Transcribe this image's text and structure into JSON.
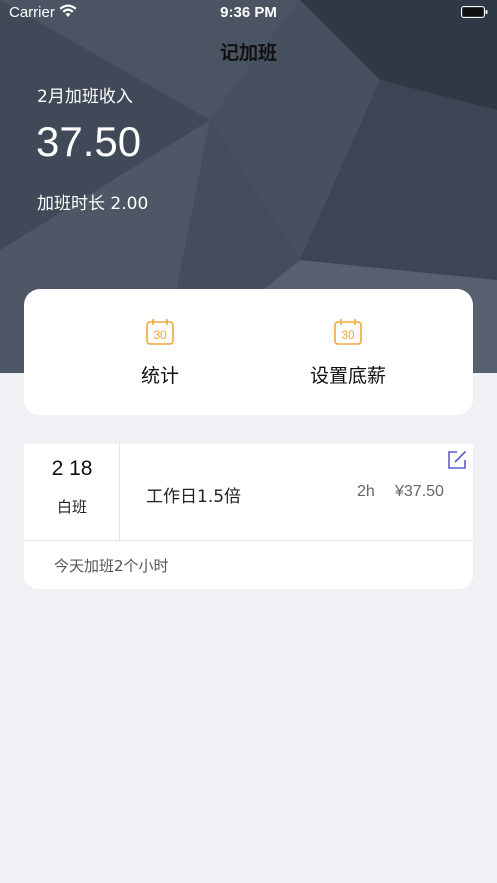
{
  "status_bar": {
    "carrier": "Carrier",
    "time": "9:36 PM"
  },
  "nav": {
    "title": "记加班"
  },
  "summary": {
    "income_label": "2月加班收入",
    "income_amount": "37.50",
    "duration_text": "加班时长 2.00"
  },
  "menu": {
    "items": [
      {
        "label": "统计",
        "icon": "calendar-icon"
      },
      {
        "label": "设置底薪",
        "icon": "calendar-icon"
      }
    ],
    "icon_text": "30"
  },
  "record": {
    "date": "2 18",
    "shift": "白班",
    "rate": "工作日1.5倍",
    "hours": "2h",
    "amount": "¥37.50",
    "note": "今天加班2个小时"
  },
  "colors": {
    "header_bg": "#3a4452",
    "accent_orange": "#f2a73b",
    "edit_icon": "#5a5fcf",
    "page_bg": "#f1f0f5"
  }
}
